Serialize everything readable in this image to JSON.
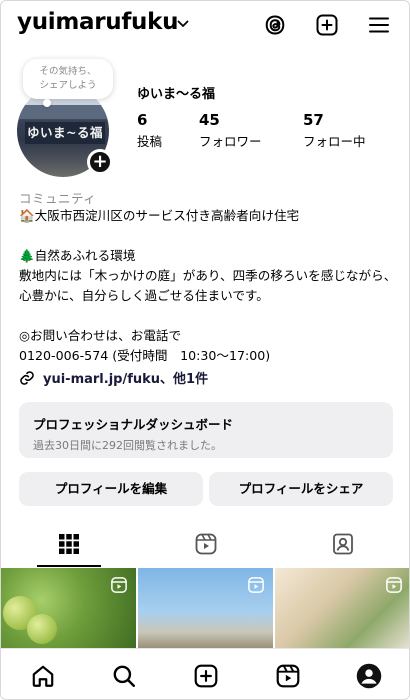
{
  "header": {
    "username": "yuimarufuku",
    "icons": [
      "chevron-down-icon",
      "threads-icon",
      "create-icon",
      "menu-icon"
    ]
  },
  "profile": {
    "note_line1": "その気持ち、",
    "note_line2": "シェアしよう",
    "avatar_sign": "ゆいま~る福",
    "display_name": "ゆいま〜る福",
    "stats": [
      {
        "value": "6",
        "label": "投稿"
      },
      {
        "value": "45",
        "label": "フォロワー"
      },
      {
        "value": "57",
        "label": "フォロー中"
      }
    ],
    "category": "コミュニティ",
    "bio": "🏠大阪市西淀川区のサービス付き高齢者向け住宅\n\n🌲自然あふれる環境\n敷地内には「木っかけの庭」があり、四季の移ろいを感じながら、心豊かに、自分らしく過ごせる住まいです。\n\n◎お問い合わせは、お電話で\n0120-006-574 (受付時間　10:30～17:00)",
    "link_text": "yui-marl.jp/fuku、他1件"
  },
  "dashboard": {
    "title": "プロフェッショナルダッシュボード",
    "subtitle": "過去30日間に292回閲覧されました。"
  },
  "buttons": {
    "edit_profile": "プロフィールを編集",
    "share_profile": "プロフィールをシェア"
  },
  "tabs": [
    "grid-icon",
    "reels-icon",
    "tagged-icon"
  ],
  "bottom_nav": [
    "home-icon",
    "search-icon",
    "create-icon",
    "reels-icon",
    "profile-icon"
  ],
  "colors": {
    "button_bg": "#efeff1",
    "secondary_text": "#8a8a8a"
  }
}
